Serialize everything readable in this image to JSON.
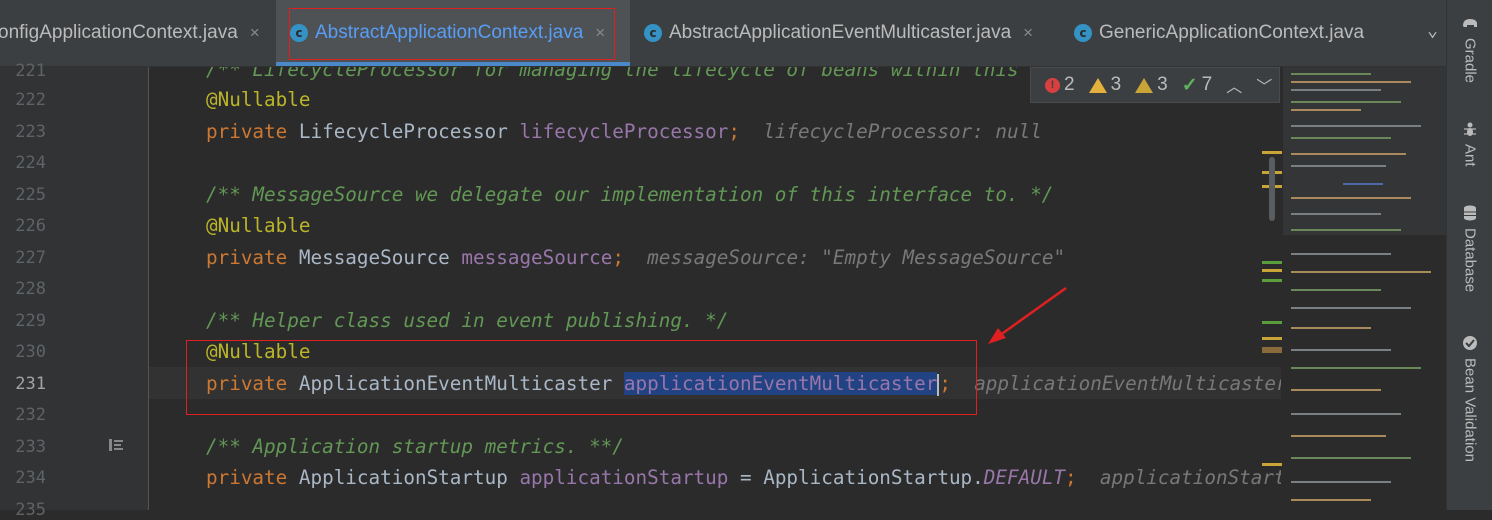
{
  "tabs": [
    {
      "label": "onfigApplicationContext.java",
      "active": false
    },
    {
      "label": "AbstractApplicationContext.java",
      "active": true
    },
    {
      "label": "AbstractApplicationEventMulticaster.java",
      "active": false
    },
    {
      "label": "GenericApplicationContext.java",
      "active": false
    }
  ],
  "tab_close_glyph": "×",
  "tab_more_glyph": "⌄",
  "class_icon_letter": "c",
  "inspections": {
    "errors": "2",
    "warnings": "3",
    "weak_warnings": "3",
    "typos": "7"
  },
  "gutter_lines": [
    "221",
    "222",
    "223",
    "224",
    "225",
    "226",
    "227",
    "228",
    "229",
    "230",
    "231",
    "232",
    "233",
    "234",
    "235"
  ],
  "current_line": "231",
  "code": {
    "l221": "/** LifecycleProcessor for managing the lifecycle of beans within this context. */",
    "l222_ann": "@Nullable",
    "l223_kw": "private",
    "l223_type": "LifecycleProcessor",
    "l223_field": "lifecycleProcessor",
    "l223_semi": ";",
    "l223_hint": "lifecycleProcessor: null",
    "l225": "/** MessageSource we delegate our implementation of this interface to. */",
    "l226_ann": "@Nullable",
    "l227_kw": "private",
    "l227_type": "MessageSource",
    "l227_field": "messageSource",
    "l227_semi": ";",
    "l227_hint": "messageSource: \"Empty MessageSource\"",
    "l229": "/** Helper class used in event publishing. */",
    "l230_ann": "@Nullable",
    "l231_kw": "private",
    "l231_type": "ApplicationEventMulticaster",
    "l231_field": "applicationEventMulticaster",
    "l231_semi": ";",
    "l231_hint": "applicationEventMulticaster",
    "l233": "/** Application startup metrics. **/",
    "l234_kw": "private",
    "l234_type": "ApplicationStartup",
    "l234_field": "applicationStartup",
    "l234_eq": " = ApplicationStartup.",
    "l234_const": "DEFAULT",
    "l234_semi": ";",
    "l234_hint": "applicationStartup"
  },
  "sidebar": [
    "Gradle",
    "Ant",
    "Database",
    "Bean Validation"
  ],
  "colors": {
    "accent": "#589df6",
    "selection": "#214283",
    "annotation_box": "#e02020"
  }
}
